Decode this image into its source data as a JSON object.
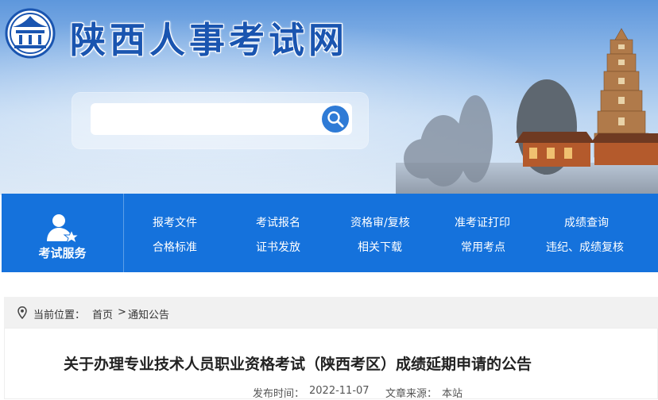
{
  "header": {
    "site_title": "陕西人事考试网",
    "search": {
      "placeholder": "",
      "value": ""
    }
  },
  "nav": {
    "service_label": "考试服务",
    "rows": [
      [
        "报考文件",
        "考试报名",
        "资格审/复核",
        "准考证打印",
        "成绩查询"
      ],
      [
        "合格标准",
        "证书发放",
        "相关下载",
        "常用考点",
        "违纪、成绩复核"
      ]
    ]
  },
  "breadcrumb": {
    "prefix": "当前位置：",
    "home": "首页",
    "separator": ">",
    "current": "通知公告"
  },
  "article": {
    "title": "关于办理专业技术人员职业资格考试（陕西考区）成绩延期申请的公告",
    "publish_label": "发布时间：",
    "publish_date": "2022-11-07",
    "source_label": "文章来源：",
    "source": "本站"
  },
  "colors": {
    "nav_blue": "#1572dc",
    "title_blue": "#1a55b0",
    "search_button": "#2f7bd6",
    "breadcrumb_bg": "#f1f1f1"
  },
  "icons": [
    "site-logo-icon",
    "search-icon",
    "user-badge-icon",
    "location-pin-icon"
  ]
}
